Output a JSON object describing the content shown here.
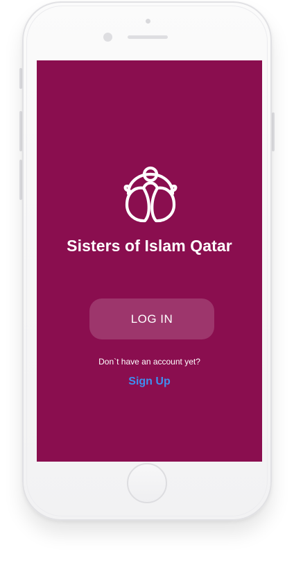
{
  "app": {
    "title": "Sisters of Islam Qatar"
  },
  "login": {
    "button_label": "LOG IN"
  },
  "signup": {
    "prompt": "Don`t have an account yet?",
    "link_label": "Sign Up"
  },
  "colors": {
    "screen_background": "#8a0e4f",
    "link": "#3f8ff0",
    "text": "#ffffff"
  },
  "icons": {
    "logo": "sisters-of-islam-qatar-logo"
  }
}
